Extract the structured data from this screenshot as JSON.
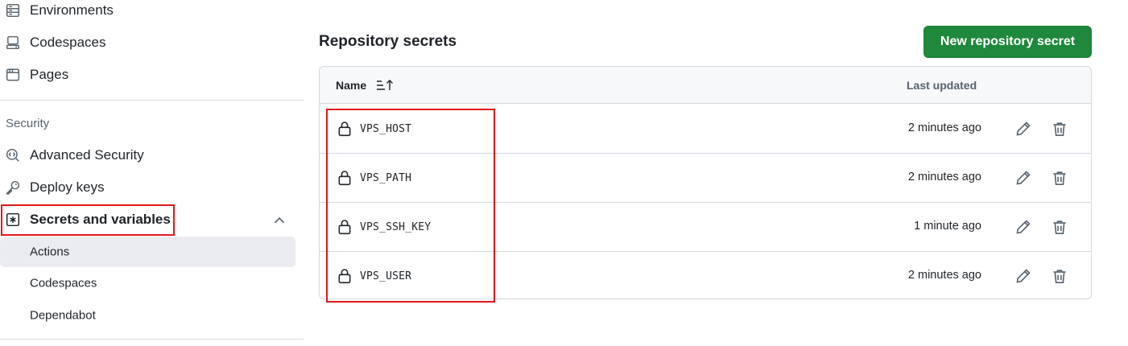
{
  "sidebar": {
    "items": [
      {
        "label": "Environments",
        "icon": "server-icon"
      },
      {
        "label": "Codespaces",
        "icon": "codespaces-icon"
      },
      {
        "label": "Pages",
        "icon": "browser-icon"
      }
    ],
    "security_section_title": "Security",
    "security_items": [
      {
        "label": "Advanced Security",
        "icon": "codescan-icon"
      },
      {
        "label": "Deploy keys",
        "icon": "key-icon"
      },
      {
        "label": "Secrets and variables",
        "icon": "asterisk-icon",
        "expanded": true
      }
    ],
    "sub_items": [
      {
        "label": "Actions",
        "active": true
      },
      {
        "label": "Codespaces",
        "active": false
      },
      {
        "label": "Dependabot",
        "active": false
      }
    ]
  },
  "main": {
    "heading": "Repository secrets",
    "new_button_label": "New repository secret",
    "table": {
      "col_name": "Name",
      "col_updated": "Last updated",
      "rows": [
        {
          "name": "VPS_HOST",
          "updated": "2 minutes ago"
        },
        {
          "name": "VPS_PATH",
          "updated": "2 minutes ago"
        },
        {
          "name": "VPS_SSH_KEY",
          "updated": "1 minute ago"
        },
        {
          "name": "VPS_USER",
          "updated": "2 minutes ago"
        }
      ]
    }
  },
  "colors": {
    "primary_button": "#1f883d",
    "highlight_box": "#e01818",
    "active_nav_bg": "#eaecf0"
  }
}
